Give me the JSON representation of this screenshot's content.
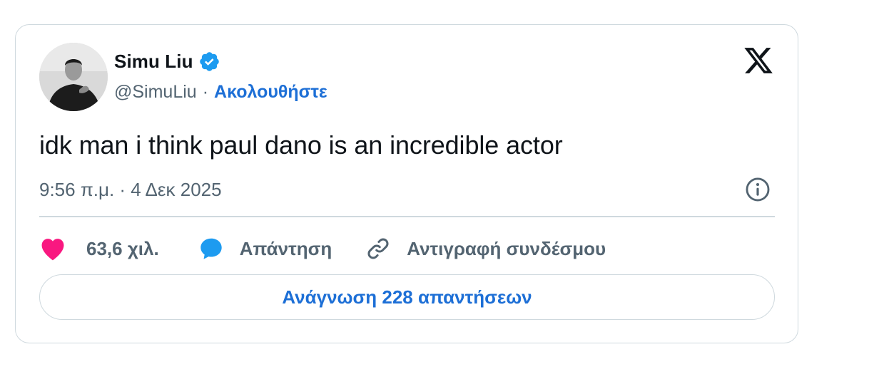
{
  "author": {
    "display_name": "Simu Liu",
    "handle": "@SimuLiu",
    "separator": "·",
    "follow_label": "Ακολουθήστε",
    "verified_icon": "verified-badge-icon",
    "avatar": "profile-photo"
  },
  "tweet": {
    "text": "idk man i think paul dano is an incredible actor",
    "timestamp": "9:56 π.μ. · 4 Δεκ 2025"
  },
  "actions": {
    "likes_label": "63,6 χιλ.",
    "reply_label": "Απάντηση",
    "copy_link_label": "Αντιγραφή συνδέσμου"
  },
  "read_replies_label": "Ανάγνωση 228 απαντήσεων",
  "colors": {
    "accent": "#1d6fd6",
    "like": "#f91880",
    "reply_icon": "#1d9bf0",
    "muted": "#536471",
    "text": "#0f1419",
    "border": "#cfd9de"
  }
}
